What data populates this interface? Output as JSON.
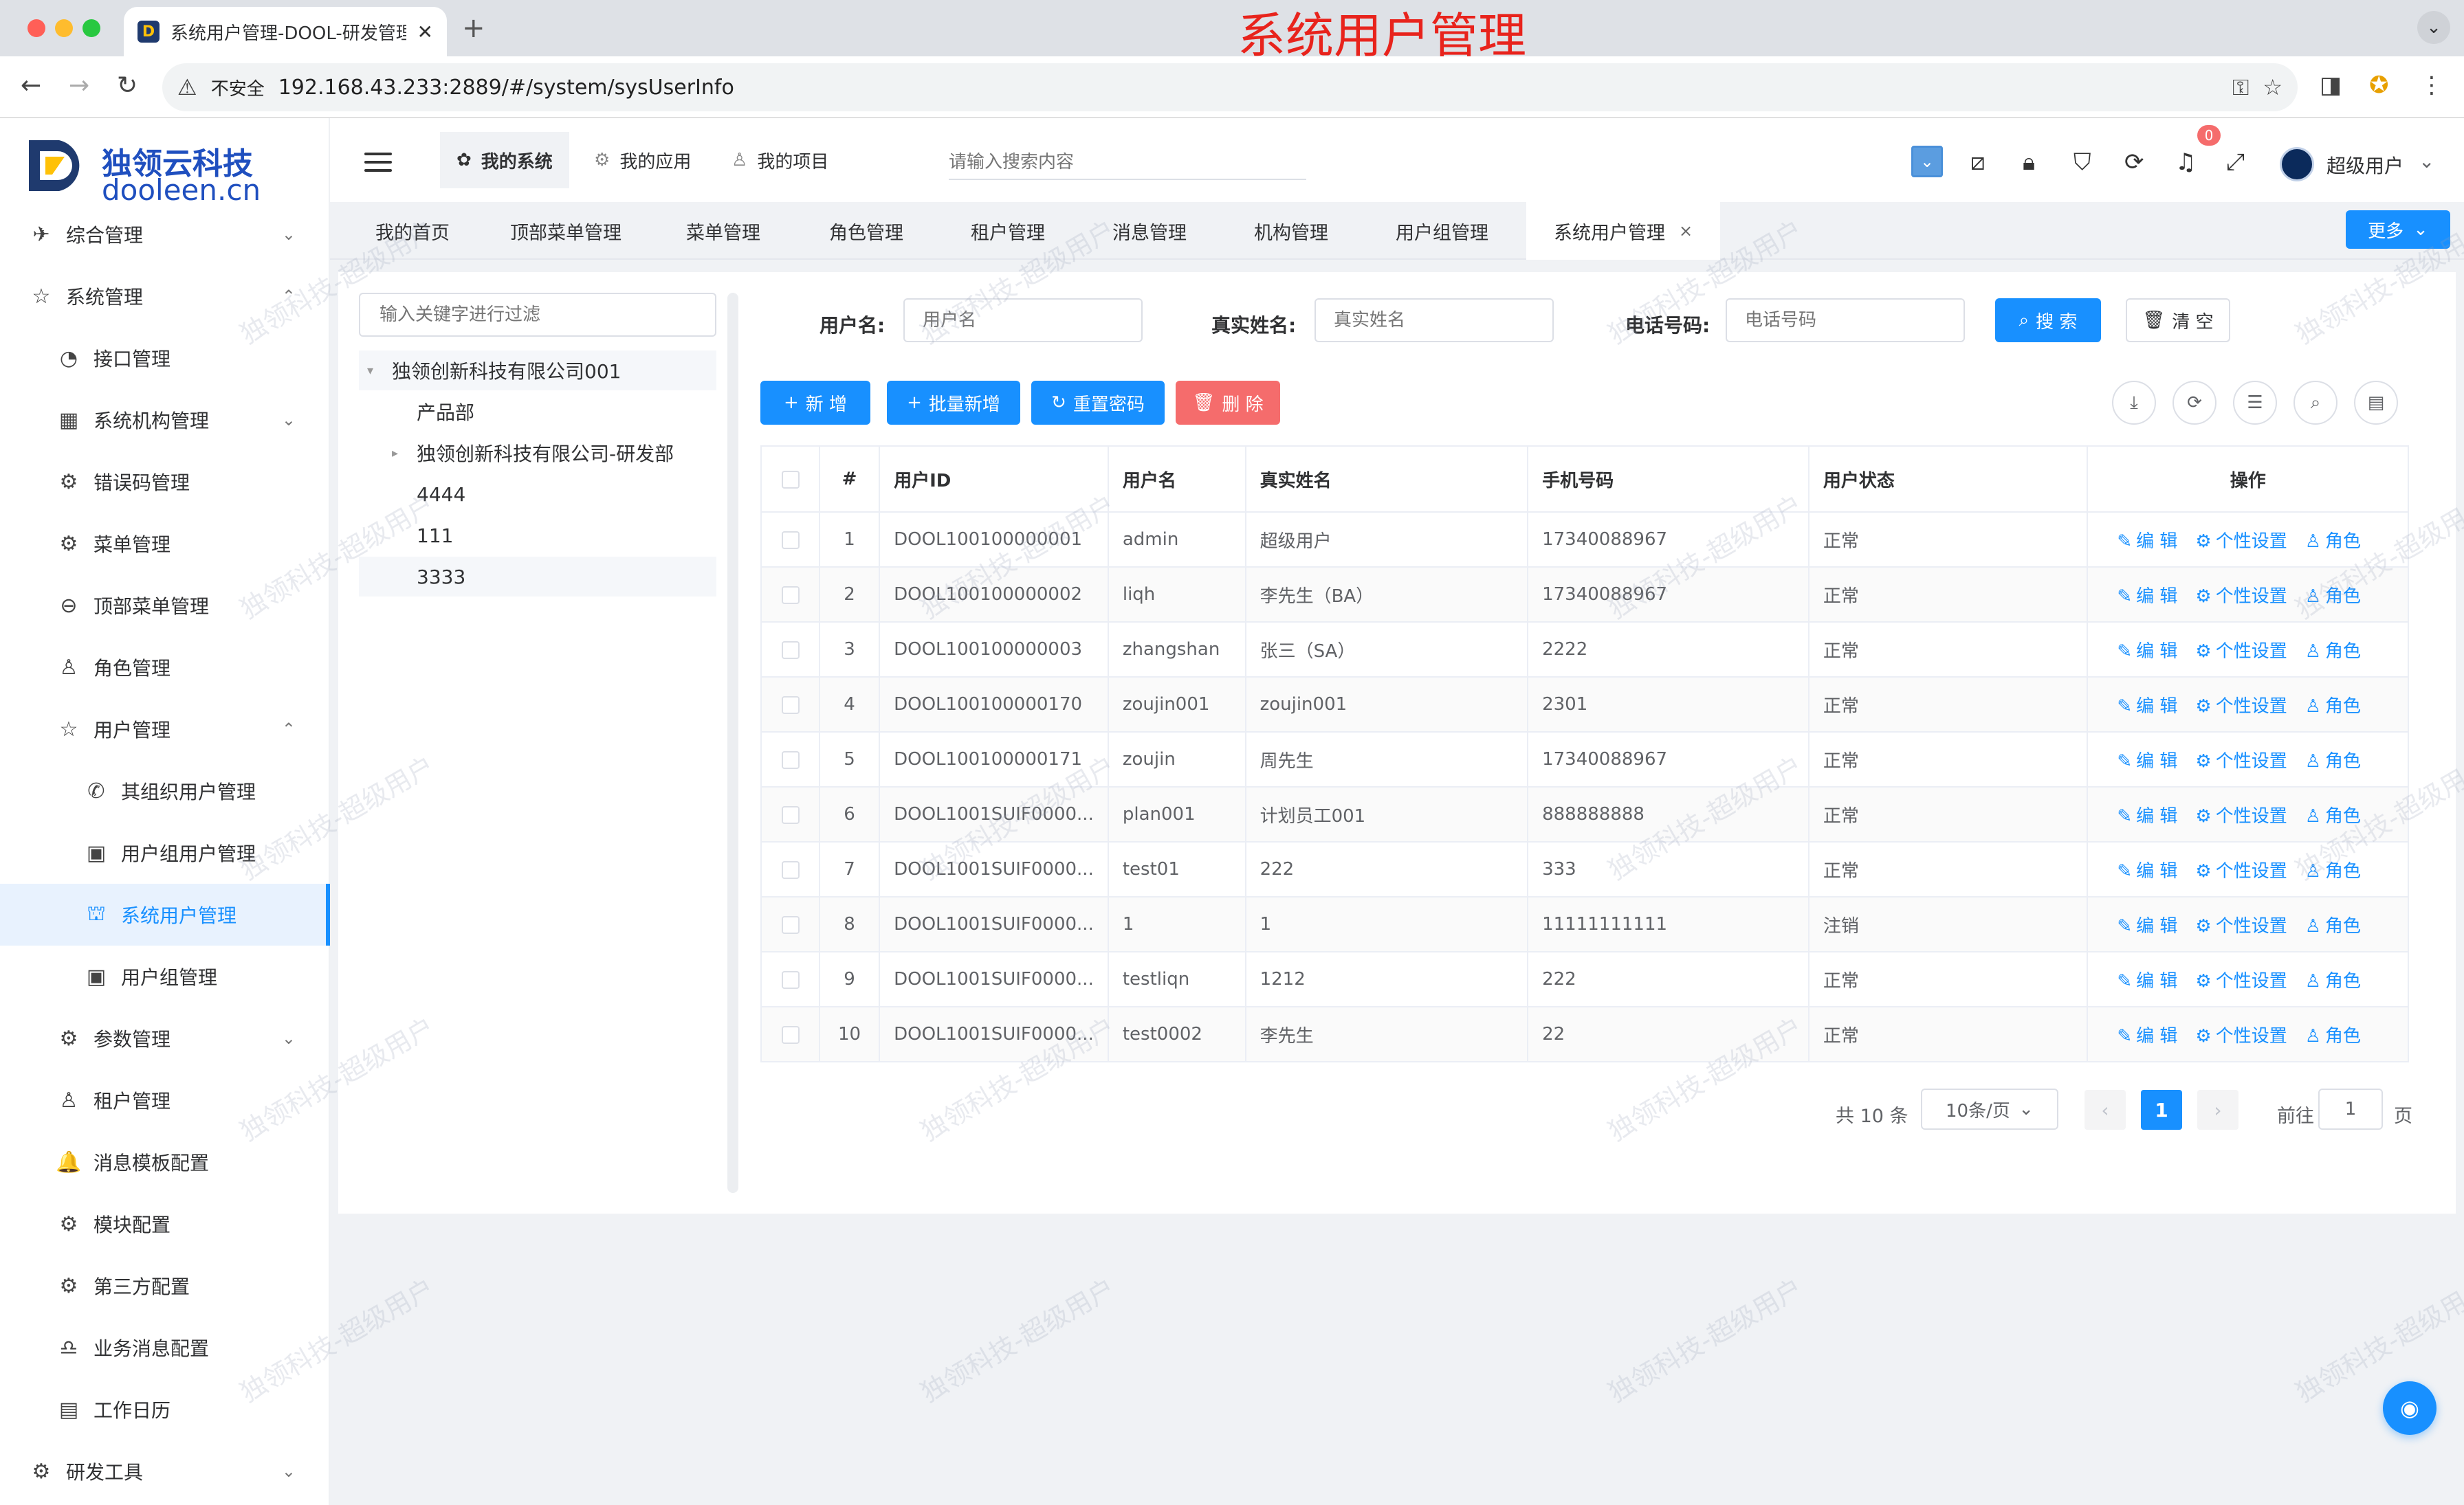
{
  "browser": {
    "tab_title": "系统用户管理-DOOL-研发管理",
    "tab_favicon": "D",
    "new_tab": "+",
    "close": "✕",
    "insecure_label": "不安全",
    "url": "192.168.43.233:2889/#/system/sysUserInfo",
    "overlay_title": "系统用户管理"
  },
  "logo": {
    "cn": "独领云科技",
    "en": "dooleen.cn"
  },
  "sidebar": {
    "items": [
      {
        "label": "综合管理",
        "icon": "send-icon",
        "glyph": "✈",
        "arrow": "⌄",
        "level": 0
      },
      {
        "label": "系统管理",
        "icon": "star-icon",
        "glyph": "☆",
        "arrow": "⌃",
        "level": 0
      },
      {
        "label": "接口管理",
        "icon": "gauge-icon",
        "glyph": "◔",
        "arrow": "",
        "level": 1
      },
      {
        "label": "系统机构管理",
        "icon": "grid-icon",
        "glyph": "▦",
        "arrow": "⌄",
        "level": 1
      },
      {
        "label": "错误码管理",
        "icon": "gear-icon",
        "glyph": "⚙",
        "arrow": "",
        "level": 1
      },
      {
        "label": "菜单管理",
        "icon": "settings-icon",
        "glyph": "⚙",
        "arrow": "",
        "level": 1
      },
      {
        "label": "顶部菜单管理",
        "icon": "search-icon",
        "glyph": "⊖",
        "arrow": "",
        "level": 1
      },
      {
        "label": "角色管理",
        "icon": "user-icon",
        "glyph": "♙",
        "arrow": "",
        "level": 1
      },
      {
        "label": "用户管理",
        "icon": "star-icon",
        "glyph": "☆",
        "arrow": "⌃",
        "level": 1
      },
      {
        "label": "其组织用户管理",
        "icon": "phone-icon",
        "glyph": "✆",
        "arrow": "",
        "level": 2
      },
      {
        "label": "用户组用户管理",
        "icon": "id-card-icon",
        "glyph": "▣",
        "arrow": "",
        "level": 2
      },
      {
        "label": "系统用户管理",
        "icon": "bag-icon",
        "glyph": "⛫",
        "arrow": "",
        "level": 2,
        "active": true
      },
      {
        "label": "用户组管理",
        "icon": "id-card-icon",
        "glyph": "▣",
        "arrow": "",
        "level": 2
      },
      {
        "label": "参数管理",
        "icon": "settings-icon",
        "glyph": "⚙",
        "arrow": "⌄",
        "level": 1
      },
      {
        "label": "租户管理",
        "icon": "user-icon",
        "glyph": "♙",
        "arrow": "",
        "level": 1
      },
      {
        "label": "消息模板配置",
        "icon": "bell-icon",
        "glyph": "🔔",
        "arrow": "",
        "level": 1
      },
      {
        "label": "模块配置",
        "icon": "settings-icon",
        "glyph": "⚙",
        "arrow": "",
        "level": 1
      },
      {
        "label": "第三方配置",
        "icon": "settings-icon",
        "glyph": "⚙",
        "arrow": "",
        "level": 1
      },
      {
        "label": "业务消息配置",
        "icon": "bell-icon",
        "glyph": "♎",
        "arrow": "",
        "level": 1
      },
      {
        "label": "工作日历",
        "icon": "calendar-icon",
        "glyph": "▤",
        "arrow": "",
        "level": 1
      },
      {
        "label": "研发工具",
        "icon": "settings-icon",
        "glyph": "⚙",
        "arrow": "⌄",
        "level": 0
      }
    ]
  },
  "header": {
    "tabs": [
      {
        "label": "我的系统",
        "glyph": "✿",
        "active": true
      },
      {
        "label": "我的应用",
        "glyph": "⚙",
        "active": false
      },
      {
        "label": "我的项目",
        "glyph": "♙",
        "active": false
      }
    ],
    "search_placeholder": "请输入搜索内容",
    "notification_count": "0",
    "username": "超级用户",
    "caret": "⌄"
  },
  "page_tabs": {
    "items": [
      {
        "label": "我的首页",
        "active": false
      },
      {
        "label": "顶部菜单管理",
        "active": false
      },
      {
        "label": "菜单管理",
        "active": false
      },
      {
        "label": "角色管理",
        "active": false
      },
      {
        "label": "租户管理",
        "active": false
      },
      {
        "label": "消息管理",
        "active": false
      },
      {
        "label": "机构管理",
        "active": false
      },
      {
        "label": "用户组管理",
        "active": false
      },
      {
        "label": "系统用户管理",
        "active": true
      }
    ],
    "close": "×",
    "more_label": "更多",
    "more_caret": "⌄"
  },
  "tree": {
    "filter_placeholder": "输入关键字进行过滤",
    "nodes": [
      {
        "label": "独领创新科技有限公司001",
        "caret": "▾",
        "indent": 0
      },
      {
        "label": "产品部",
        "caret": "",
        "indent": 1
      },
      {
        "label": "独领创新科技有限公司-研发部",
        "caret": "▸",
        "indent": 1
      },
      {
        "label": "4444",
        "caret": "",
        "indent": 1
      },
      {
        "label": "111",
        "caret": "",
        "indent": 1
      },
      {
        "label": "3333",
        "caret": "",
        "indent": 1
      }
    ]
  },
  "search_form": {
    "username_label": "用户名:",
    "username_placeholder": "用户名",
    "realname_label": "真实姓名:",
    "realname_placeholder": "真实姓名",
    "phone_label": "电话号码:",
    "phone_placeholder": "电话号码",
    "search_label": "搜 索",
    "clear_label": "清 空"
  },
  "toolbar": {
    "add_label": "新 增",
    "batch_add_label": "批量新增",
    "reset_pwd_label": "重置密码",
    "delete_label": "删 除"
  },
  "table": {
    "headers": {
      "index": "#",
      "user_id": "用户ID",
      "username": "用户名",
      "realname": "真实姓名",
      "phone": "手机号码",
      "status": "用户状态",
      "ops": "操作"
    },
    "op_labels": {
      "edit": "编 辑",
      "personal": "个性设置",
      "role": "角色"
    },
    "rows": [
      {
        "index": "1",
        "user_id": "DOOL100100000001",
        "username": "admin",
        "realname": "超级用户",
        "phone": "17340088967",
        "status": "正常"
      },
      {
        "index": "2",
        "user_id": "DOOL100100000002",
        "username": "liqh",
        "realname": "李先生（BA）",
        "phone": "17340088967",
        "status": "正常"
      },
      {
        "index": "3",
        "user_id": "DOOL100100000003",
        "username": "zhangshan",
        "realname": "张三（SA）",
        "phone": "2222",
        "status": "正常"
      },
      {
        "index": "4",
        "user_id": "DOOL100100000170",
        "username": "zoujin001",
        "realname": "zoujin001",
        "phone": "2301",
        "status": "正常"
      },
      {
        "index": "5",
        "user_id": "DOOL100100000171",
        "username": "zoujin",
        "realname": "周先生",
        "phone": "17340088967",
        "status": "正常"
      },
      {
        "index": "6",
        "user_id": "DOOL1001SUIF0000...",
        "username": "plan001",
        "realname": "计划员工001",
        "phone": "888888888",
        "status": "正常"
      },
      {
        "index": "7",
        "user_id": "DOOL1001SUIF0000...",
        "username": "test01",
        "realname": "222",
        "phone": "333",
        "status": "正常"
      },
      {
        "index": "8",
        "user_id": "DOOL1001SUIF0000...",
        "username": "1",
        "realname": "1",
        "phone": "11111111111",
        "status": "注销"
      },
      {
        "index": "9",
        "user_id": "DOOL1001SUIF0000...",
        "username": "testliqn",
        "realname": "1212",
        "phone": "222",
        "status": "正常"
      },
      {
        "index": "10",
        "user_id": "DOOL1001SUIF0000...",
        "username": "test0002",
        "realname": "李先生",
        "phone": "22",
        "status": "正常"
      }
    ]
  },
  "pagination": {
    "total": "共 10 条",
    "page_size": "10条/页",
    "current": "1",
    "goto_label": "前往",
    "goto_value": "1",
    "page_suffix": "页",
    "prev": "‹",
    "next": "›"
  },
  "watermark": "独领科技-超级用户",
  "colors": {
    "primary": "#1890ff",
    "danger": "#f56c6c",
    "overlay": "#e8231c"
  }
}
